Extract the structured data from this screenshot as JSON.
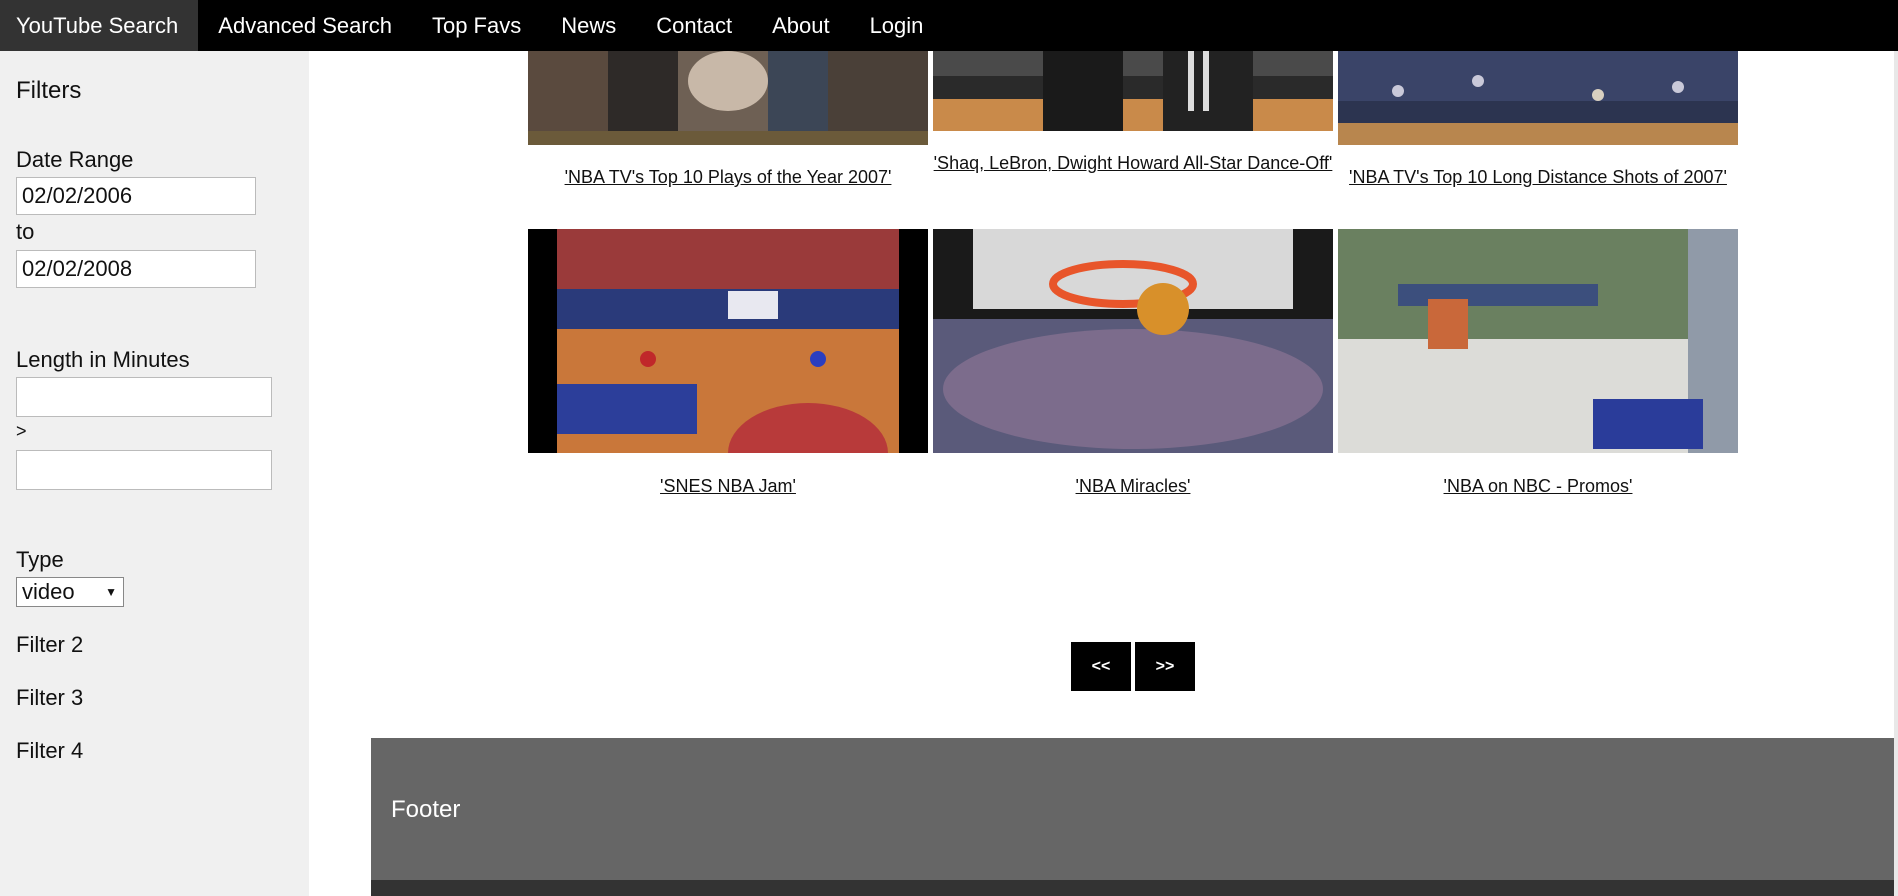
{
  "nav": {
    "items": [
      {
        "label": "YouTube Search"
      },
      {
        "label": "Advanced Search"
      },
      {
        "label": "Top Favs"
      },
      {
        "label": "News"
      },
      {
        "label": "Contact"
      },
      {
        "label": "About"
      },
      {
        "label": "Login"
      }
    ]
  },
  "sidebar": {
    "title": "Filters",
    "date_range_label": "Date Range",
    "date_from": "02/02/2006",
    "to_label": "to",
    "date_to": "02/02/2008",
    "length_label": "Length in Minutes",
    "length_sep": ">",
    "length_min": "",
    "length_max": "",
    "type_label": "Type",
    "type_value": "video",
    "filter2": "Filter 2",
    "filter3": "Filter 3",
    "filter4": "Filter 4"
  },
  "results": {
    "row1": [
      {
        "title": "'NBA TV's Top 10 Plays of the Year 2007'"
      },
      {
        "title": "'Shaq, LeBron, Dwight Howard All-Star Dance-Off'"
      },
      {
        "title": "'NBA TV's Top 10 Long Distance Shots of 2007'"
      }
    ],
    "row2": [
      {
        "title": "'SNES NBA Jam'"
      },
      {
        "title": "'NBA Miracles'"
      },
      {
        "title": "'NBA on NBC - Promos'"
      }
    ]
  },
  "pager": {
    "prev": "<<",
    "next": ">>"
  },
  "footer": {
    "text": "Footer"
  },
  "colors": {
    "nav_bg": "#000000",
    "sidebar_bg": "#f0f0f0",
    "footer_bg": "#666666"
  }
}
